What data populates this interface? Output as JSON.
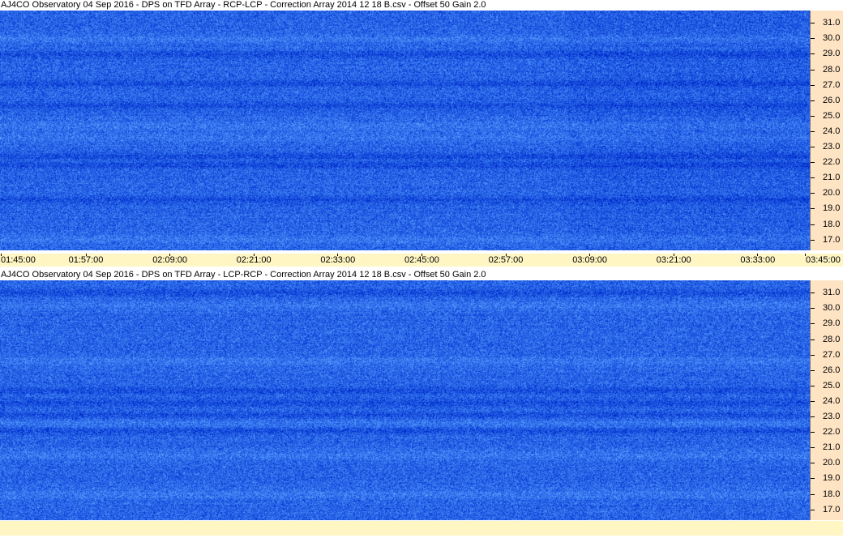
{
  "colors": {
    "axis_bg": "#ffe4c4",
    "time_bar_bg": "#fff6c4",
    "spectrogram_base": "#1f5fe6"
  },
  "chart_data": [
    {
      "type": "heatmap",
      "title": "AJ4CO Observatory 04 Sep 2016  -  DPS on TFD Array  -  RCP-LCP  -  Correction Array 2014 12 18 B.csv  -  Offset 50  Gain 2.0",
      "y_ticks": [
        "31.0",
        "30.0",
        "29.0",
        "28.0",
        "27.0",
        "26.0",
        "25.0",
        "24.0",
        "23.0",
        "22.0",
        "21.0",
        "20.0",
        "19.0",
        "18.0",
        "17.0"
      ],
      "ylim": [
        16.3,
        31.8
      ],
      "x_ticks": [
        "01:45:00",
        "01:57:00",
        "02:09:00",
        "02:21:00",
        "02:33:00",
        "02:45:00",
        "02:57:00",
        "03:09:00",
        "03:21:00",
        "03:33:00",
        "03:45:00"
      ],
      "x_range": [
        "01:45:00",
        "03:45:00"
      ],
      "dark_bands_mhz": [
        29.0,
        27.1,
        25.7,
        22.4,
        21.8,
        19.6
      ],
      "light_bands_mhz": [
        30.0,
        24.4,
        23.6,
        17.0
      ]
    },
    {
      "type": "heatmap",
      "title": "AJ4CO Observatory 04 Sep 2016  -  DPS on TFD Array  -  LCP-RCP  -  Correction Array 2014 12 18 B.csv  -  Offset 50  Gain 2.0",
      "y_ticks": [
        "31.0",
        "30.0",
        "29.0",
        "28.0",
        "27.0",
        "26.0",
        "25.0",
        "24.0",
        "23.0",
        "22.0",
        "21.0",
        "20.0",
        "19.0",
        "18.0",
        "17.0"
      ],
      "ylim": [
        16.3,
        31.8
      ],
      "x_ticks": [],
      "x_range": [
        "01:45:00",
        "03:45:00"
      ],
      "dark_bands_mhz": [
        31.0,
        24.7,
        23.9,
        23.1,
        22.1
      ],
      "light_bands_mhz": [
        30.2,
        26.6,
        22.6,
        20.5,
        18.0
      ]
    }
  ]
}
